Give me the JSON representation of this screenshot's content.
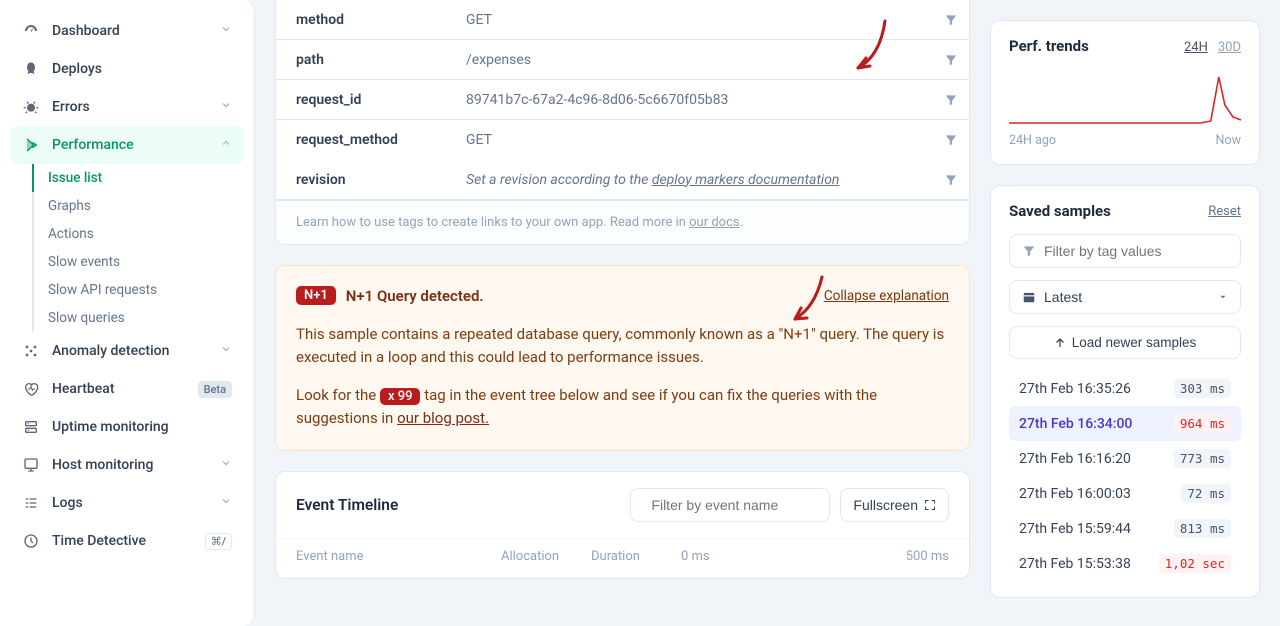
{
  "sidebar": {
    "items": [
      {
        "icon": "gauge",
        "label": "Dashboard",
        "chevron": true
      },
      {
        "icon": "rocket",
        "label": "Deploys"
      },
      {
        "icon": "bug",
        "label": "Errors",
        "chevron": true
      },
      {
        "icon": "speed",
        "label": "Performance",
        "chevron": true,
        "active": true,
        "expanded": true
      },
      {
        "icon": "sparkle",
        "label": "Anomaly detection",
        "chevron": true
      },
      {
        "icon": "heart",
        "label": "Heartbeat",
        "badge": "Beta"
      },
      {
        "icon": "uptime",
        "label": "Uptime monitoring"
      },
      {
        "icon": "host",
        "label": "Host monitoring",
        "chevron": true
      },
      {
        "icon": "logs",
        "label": "Logs",
        "chevron": true
      },
      {
        "icon": "clock",
        "label": "Time Detective",
        "kbd": "⌘/"
      }
    ],
    "performance_sub": [
      {
        "label": "Issue list",
        "active": true
      },
      {
        "label": "Graphs"
      },
      {
        "label": "Actions"
      },
      {
        "label": "Slow events"
      },
      {
        "label": "Slow API requests"
      },
      {
        "label": "Slow queries"
      }
    ]
  },
  "details": {
    "rows": [
      {
        "key": "method",
        "val": "GET"
      },
      {
        "key": "path",
        "val": "/expenses"
      },
      {
        "key": "request_id",
        "val": "89741b7c-67a2-4c96-8d06-5c6670f05b83"
      },
      {
        "key": "request_method",
        "val": "GET"
      }
    ],
    "revision_key": "revision",
    "revision_prefix": "Set a revision according to the ",
    "revision_link": "deploy markers documentation",
    "hint_prefix": "Learn how to use tags to create links to your own app. Read more in ",
    "hint_link": "our docs",
    "hint_suffix": "."
  },
  "alert": {
    "badge": "N+1",
    "title": "N+1 Query detected.",
    "collapse": "Collapse explanation",
    "p1": "This sample contains a repeated database query, commonly known as a \"N+1\" query. The query is executed in a loop and this could lead to performance issues.",
    "p2_a": "Look for the ",
    "p2_tag": "x 99",
    "p2_b": " tag in the event tree below and see if you can fix the queries with the suggestions in ",
    "p2_link": "our blog post."
  },
  "timeline": {
    "title": "Event Timeline",
    "filter_placeholder": "Filter by event name",
    "fullscreen": "Fullscreen",
    "cols": [
      "Event name",
      "Allocation",
      "Duration",
      "0 ms",
      "500 ms"
    ]
  },
  "trends": {
    "title": "Perf. trends",
    "range1": "24H",
    "range2": "30D",
    "label_left": "24H ago",
    "label_right": "Now"
  },
  "samples": {
    "title": "Saved samples",
    "reset": "Reset",
    "filter_placeholder": "Filter by tag values",
    "sort": "Latest",
    "load": "Load newer samples",
    "rows": [
      {
        "ts": "27th Feb 16:35:26",
        "ms": "303 ms"
      },
      {
        "ts": "27th Feb 16:34:00",
        "ms": "964 ms",
        "warn": true,
        "selected": true
      },
      {
        "ts": "27th Feb 16:16:20",
        "ms": "773 ms"
      },
      {
        "ts": "27th Feb 16:00:03",
        "ms": "72 ms"
      },
      {
        "ts": "27th Feb 15:59:44",
        "ms": "813 ms"
      },
      {
        "ts": "27th Feb 15:53:38",
        "ms": "1,02 sec",
        "warn": true
      }
    ]
  }
}
